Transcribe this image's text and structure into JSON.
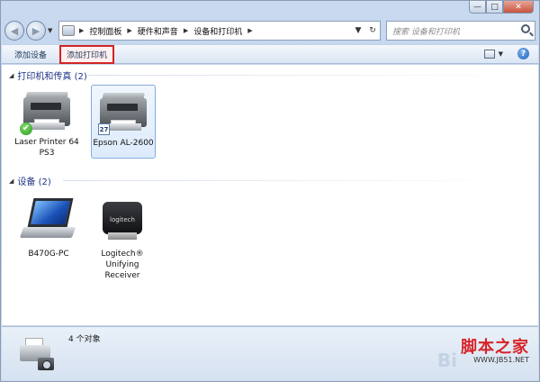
{
  "window": {
    "buttons": {
      "minimize": "—",
      "maximize": "□",
      "close": "✕"
    }
  },
  "nav": {
    "back_icon": "back-arrow-icon",
    "forward_icon": "forward-arrow-icon",
    "dropdown_glyph": "▼",
    "breadcrumb": [
      "控制面板",
      "硬件和声音",
      "设备和打印机"
    ],
    "refresh_glyph": "↻",
    "search_placeholder": "搜索 设备和打印机"
  },
  "toolbar": {
    "add_device": "添加设备",
    "add_printer": "添加打印机",
    "highlight_color": "#d22424",
    "help_label": "?"
  },
  "groups": [
    {
      "title": "打印机和传真 (2)",
      "items": [
        {
          "label_line1": "Laser Printer 64",
          "label_line2": "PS3",
          "default": true
        },
        {
          "label_line1": "Epson AL-2600",
          "badge": "27",
          "selected": true
        }
      ]
    },
    {
      "title": "设备 (2)",
      "items": [
        {
          "label_line1": "B470G-PC"
        },
        {
          "label_line1": "Logitech®",
          "label_line2": "Unifying",
          "label_line3": "Receiver",
          "logo": "logitech"
        }
      ]
    }
  ],
  "details": {
    "count_text": "4 个对象"
  },
  "watermark": {
    "faint": "Bi",
    "main": "脚本之家",
    "url": "WWW.JB51.NET"
  },
  "colors": {
    "group_header": "#1e3287",
    "selection_border": "#84acdd",
    "default_check": "#2a9b1d"
  }
}
